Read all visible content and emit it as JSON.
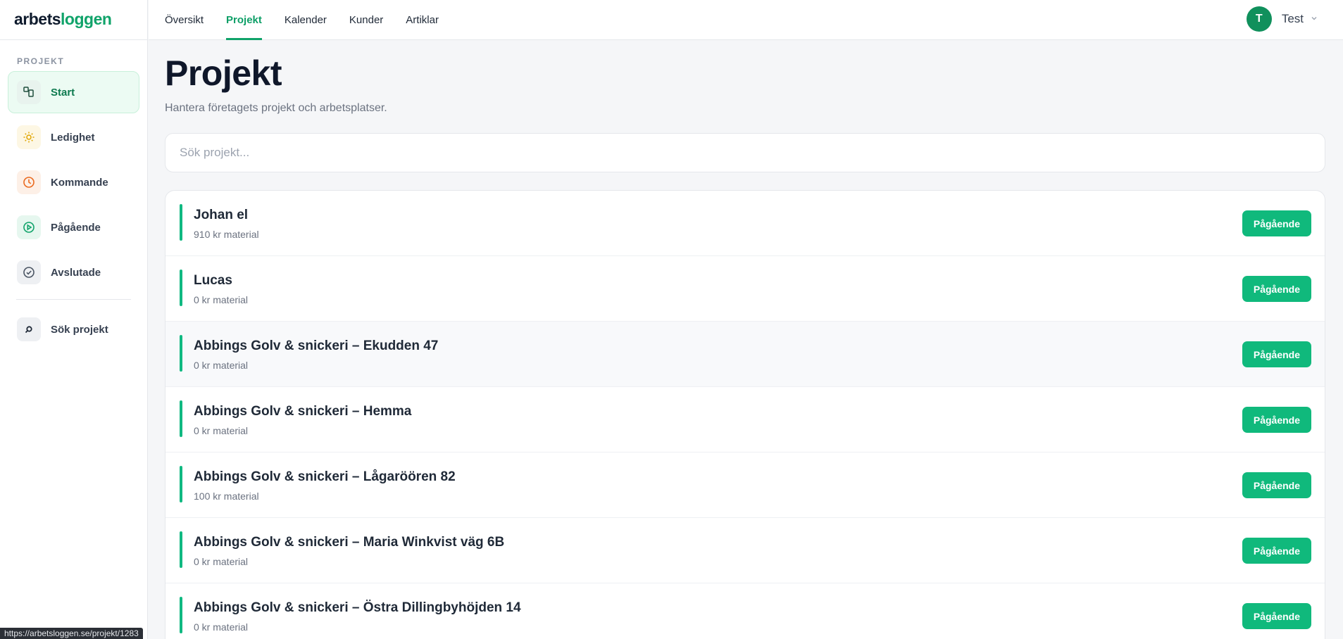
{
  "brand": {
    "logo_part1": "arbets",
    "logo_part2": "loggen",
    "color": "#10a36a"
  },
  "sidebar": {
    "section_title": "PROJEKT",
    "items": [
      {
        "label": "Start",
        "icon": "layout-icon",
        "active": true
      },
      {
        "label": "Ledighet",
        "icon": "sun-icon"
      },
      {
        "label": "Kommande",
        "icon": "clock-icon"
      },
      {
        "label": "Pågående",
        "icon": "play-circle-icon"
      },
      {
        "label": "Avslutade",
        "icon": "check-circle-icon"
      }
    ],
    "search_item": {
      "label": "Sök projekt",
      "icon": "search-icon"
    }
  },
  "topnav": {
    "tabs": [
      {
        "label": "Översikt"
      },
      {
        "label": "Projekt",
        "active": true
      },
      {
        "label": "Kalender"
      },
      {
        "label": "Kunder"
      },
      {
        "label": "Artiklar"
      }
    ],
    "user": {
      "initial": "T",
      "name": "Test"
    }
  },
  "main": {
    "title": "Projekt",
    "subtitle": "Hantera företagets projekt och arbetsplatser.",
    "search": {
      "placeholder": "Sök projekt..."
    },
    "projects": [
      {
        "name": "Johan el",
        "meta": "910 kr material",
        "status": "Pågående"
      },
      {
        "name": "Lucas",
        "meta": "0 kr material",
        "status": "Pågående"
      },
      {
        "name": "Abbings Golv & snickeri – Ekudden 47",
        "meta": "0 kr material",
        "status": "Pågående"
      },
      {
        "name": "Abbings Golv & snickeri – Hemma",
        "meta": "0 kr material",
        "status": "Pågående"
      },
      {
        "name": "Abbings Golv & snickeri – Lågaröören 82",
        "meta": "100 kr material",
        "status": "Pågående"
      },
      {
        "name": "Abbings Golv & snickeri – Maria Winkvist väg 6B",
        "meta": "0 kr material",
        "status": "Pågående"
      },
      {
        "name": "Abbings Golv & snickeri – Östra Dillingbyhöjden 14",
        "meta": "0 kr material",
        "status": "Pågående"
      }
    ]
  },
  "browser_status": {
    "url": "https://arbetsloggen.se/projekt/1283"
  }
}
